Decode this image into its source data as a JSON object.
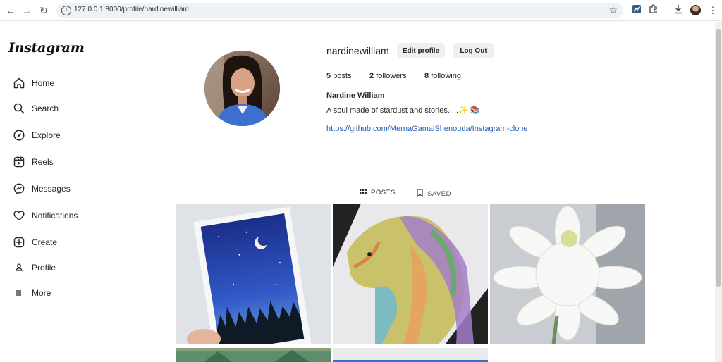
{
  "browser": {
    "url": "127.0.0.1:8000/profile/nardinewilliam"
  },
  "sidebar": {
    "logo": "Instagram",
    "items": [
      {
        "label": "Home",
        "icon": "home-icon"
      },
      {
        "label": "Search",
        "icon": "search-icon"
      },
      {
        "label": "Explore",
        "icon": "compass-icon"
      },
      {
        "label": "Reels",
        "icon": "reels-icon"
      },
      {
        "label": "Messages",
        "icon": "messenger-icon"
      },
      {
        "label": "Notifications",
        "icon": "heart-icon"
      },
      {
        "label": "Create",
        "icon": "plus-square-icon"
      },
      {
        "label": "Profile",
        "icon": "person-icon"
      },
      {
        "label": "More",
        "icon": "menu-icon"
      }
    ]
  },
  "profile": {
    "username": "nardinewilliam",
    "edit_label": "Edit profile",
    "logout_label": "Log Out",
    "posts_count": "5",
    "posts_label": "posts",
    "followers_count": "2",
    "followers_label": "followers",
    "following_count": "8",
    "following_label": "following",
    "full_name": "Nardine William",
    "bio": "A soul made of stardust and stories.....✨ 📚",
    "link": "https://github.com/MernaGamalShenouda/Instagram-clone"
  },
  "tabs": {
    "posts_label": "POSTS",
    "saved_label": "SAVED"
  },
  "colors": {
    "link": "#1f5fb8",
    "button_bg": "#efefef",
    "divider": "#dbdbdb"
  }
}
